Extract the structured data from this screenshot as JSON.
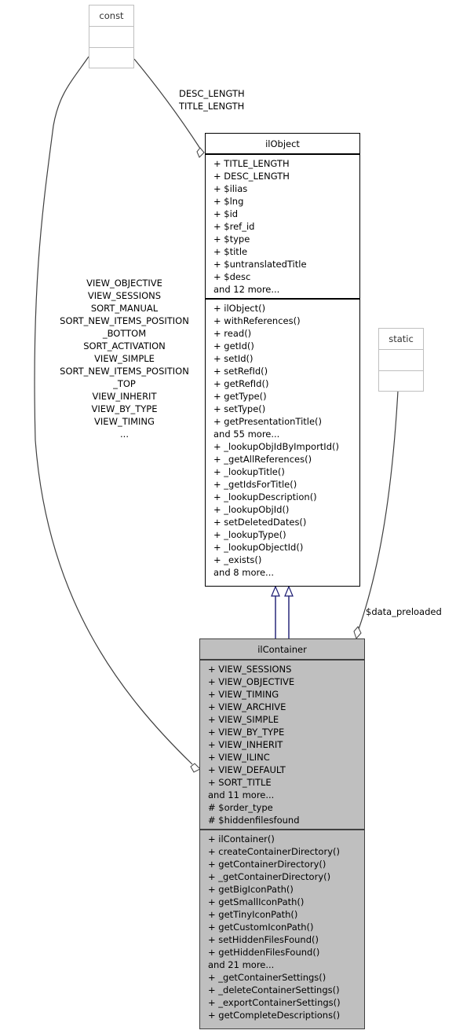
{
  "classes": {
    "const": {
      "name": "const"
    },
    "static": {
      "name": "static"
    },
    "ilObject": {
      "name": "ilObject",
      "attributes": [
        "+ TITLE_LENGTH",
        "+ DESC_LENGTH",
        "+ $ilias",
        "+ $lng",
        "+ $id",
        "+ $ref_id",
        "+ $type",
        "+ $title",
        "+ $untranslatedTitle",
        "+ $desc",
        "and 12 more..."
      ],
      "methods": [
        "+ ilObject()",
        "+ withReferences()",
        "+ read()",
        "+ getId()",
        "+ setId()",
        "+ setRefId()",
        "+ getRefId()",
        "+ getType()",
        "+ setType()",
        "+ getPresentationTitle()",
        "and 55 more...",
        "+ _lookupObjIdByImportId()",
        "+ _getAllReferences()",
        "+ _lookupTitle()",
        "+ _getIdsForTitle()",
        "+ _lookupDescription()",
        "+ _lookupObjId()",
        "+ setDeletedDates()",
        "+ _lookupType()",
        "+ _lookupObjectId()",
        "+ _exists()",
        "and 8 more..."
      ]
    },
    "ilContainer": {
      "name": "ilContainer",
      "attributes": [
        "+ VIEW_SESSIONS",
        "+ VIEW_OBJECTIVE",
        "+ VIEW_TIMING",
        "+ VIEW_ARCHIVE",
        "+ VIEW_SIMPLE",
        "+ VIEW_BY_TYPE",
        "+ VIEW_INHERIT",
        "+ VIEW_ILINC",
        "+ VIEW_DEFAULT",
        "+ SORT_TITLE",
        "and 11 more...",
        "# $order_type",
        "# $hiddenfilesfound"
      ],
      "methods": [
        "+ ilContainer()",
        "+ createContainerDirectory()",
        "+ getContainerDirectory()",
        "+ _getContainerDirectory()",
        "+ getBigIconPath()",
        "+ getSmallIconPath()",
        "+ getTinyIconPath()",
        "+ getCustomIconPath()",
        "+ setHiddenFilesFound()",
        "+ getHiddenFilesFound()",
        "and 21 more...",
        "+ _getContainerSettings()",
        "+ _deleteContainerSettings()",
        "+ _exportContainerSettings()",
        "+ getCompleteDescriptions()"
      ]
    }
  },
  "edge_labels": {
    "const_to_ilObject": [
      "DESC_LENGTH",
      "TITLE_LENGTH"
    ],
    "const_to_ilContainer": [
      "VIEW_OBJECTIVE",
      "VIEW_SESSIONS",
      "SORT_MANUAL",
      "SORT_NEW_ITEMS_POSITION",
      "_BOTTOM",
      "SORT_ACTIVATION",
      "VIEW_SIMPLE",
      "SORT_NEW_ITEMS_POSITION",
      "_TOP",
      "VIEW_INHERIT",
      "VIEW_BY_TYPE",
      "VIEW_TIMING",
      "..."
    ],
    "static_to_ilContainer": [
      "$data_preloaded"
    ]
  },
  "colors": {
    "inheritance_edge": "#191970",
    "association_edge": "#404040",
    "derived_class_fill": "#bfbfbf"
  }
}
